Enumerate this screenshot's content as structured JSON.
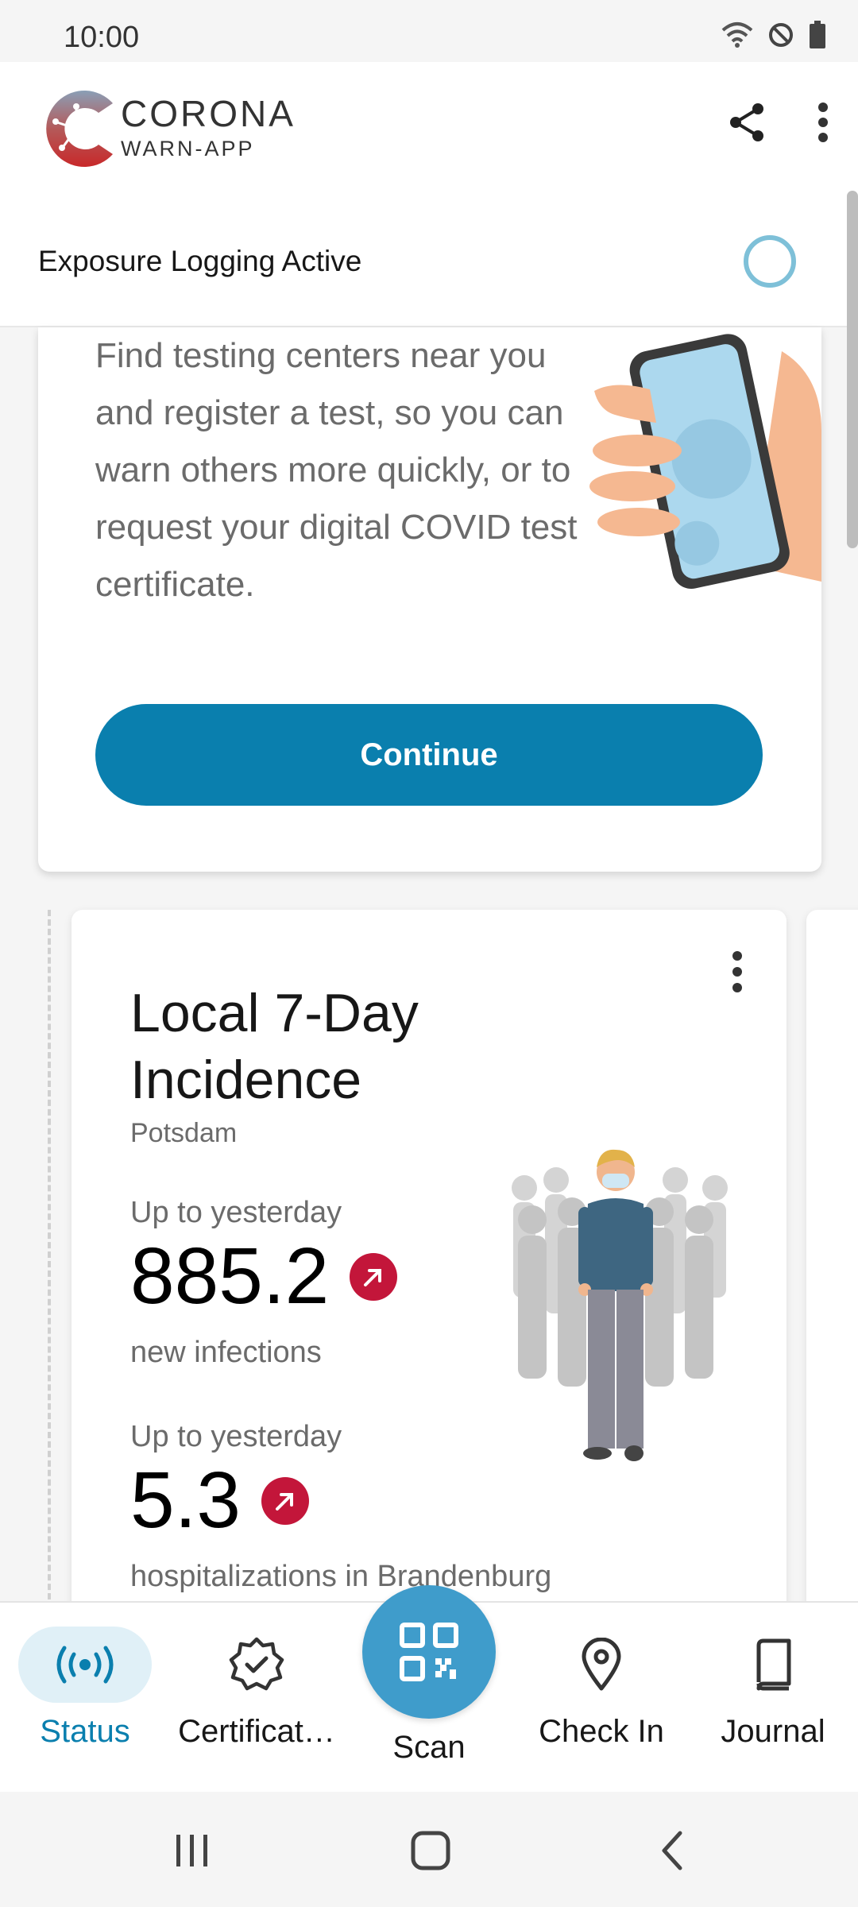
{
  "status_bar": {
    "time": "10:00",
    "icons": [
      "wifi-icon",
      "do-not-disturb-icon",
      "battery-icon"
    ]
  },
  "app": {
    "brand_line1": "CORONA",
    "brand_line2": "WARN-APP",
    "actions": [
      "share-icon",
      "more-vert-icon"
    ]
  },
  "exposure": {
    "label": "Exposure Logging Active",
    "indicator_color": "#7ec0d8"
  },
  "test_card": {
    "body": "Find testing centers near you and register a test, so you can warn others more quickly, or to request your digital COVID test certificate.",
    "button_label": "Continue",
    "button_color": "#0a7fae"
  },
  "incidence_card": {
    "title": "Local 7-Day Incidence",
    "location": "Potsdam",
    "stat1_label": "Up to yesterday",
    "stat1_value": "885.2",
    "stat1_desc": "new infections",
    "stat1_trend": "up",
    "stat2_label": "Up to yesterday",
    "stat2_value": "5.3",
    "stat2_desc": "hospitalizations in Brandenburg",
    "stat2_trend": "up",
    "trend_color": "#c3163a"
  },
  "bottom_nav": {
    "items": [
      {
        "label": "Status",
        "icon": "exposure-radar-icon",
        "active": true
      },
      {
        "label": "Certificat…",
        "icon": "certificate-badge-icon",
        "active": false
      },
      {
        "label": "Scan",
        "icon": "qr-code-icon",
        "active": false
      },
      {
        "label": "Check In",
        "icon": "location-pin-icon",
        "active": false
      },
      {
        "label": "Journal",
        "icon": "journal-book-icon",
        "active": false
      }
    ],
    "active_color": "#0a7fae"
  }
}
